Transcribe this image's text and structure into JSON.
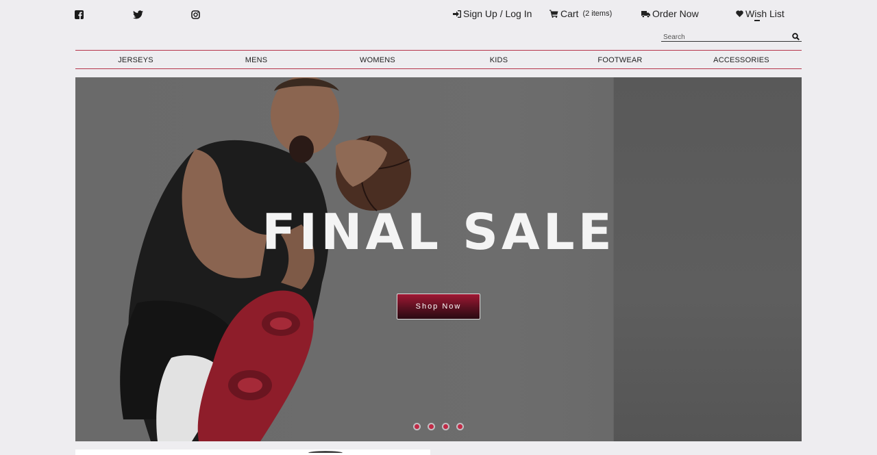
{
  "social": {
    "facebook_icon": "facebook-icon",
    "twitter_icon": "twitter-icon",
    "instagram_icon": "instagram-icon"
  },
  "header": {
    "signup_label": "Sign Up / Log In",
    "cart_label": "Cart",
    "cart_count": "(2 items)",
    "order_label": "Order Now",
    "wishlist_label": "Wish List"
  },
  "search": {
    "placeholder": "Search"
  },
  "nav": {
    "items": [
      {
        "label": "JERSEYS"
      },
      {
        "label": "MENS"
      },
      {
        "label": "WOMENS"
      },
      {
        "label": "KIDS"
      },
      {
        "label": "FOOTWEAR"
      },
      {
        "label": "ACCESSORIES"
      }
    ]
  },
  "hero": {
    "title": "FINAL SALE",
    "button_label": "Shop Now",
    "slide_count": 4
  },
  "colors": {
    "accent": "#b5344a",
    "button_top": "#a01834",
    "button_bottom": "#2a0a12",
    "page_bg": "#eeedf0"
  }
}
